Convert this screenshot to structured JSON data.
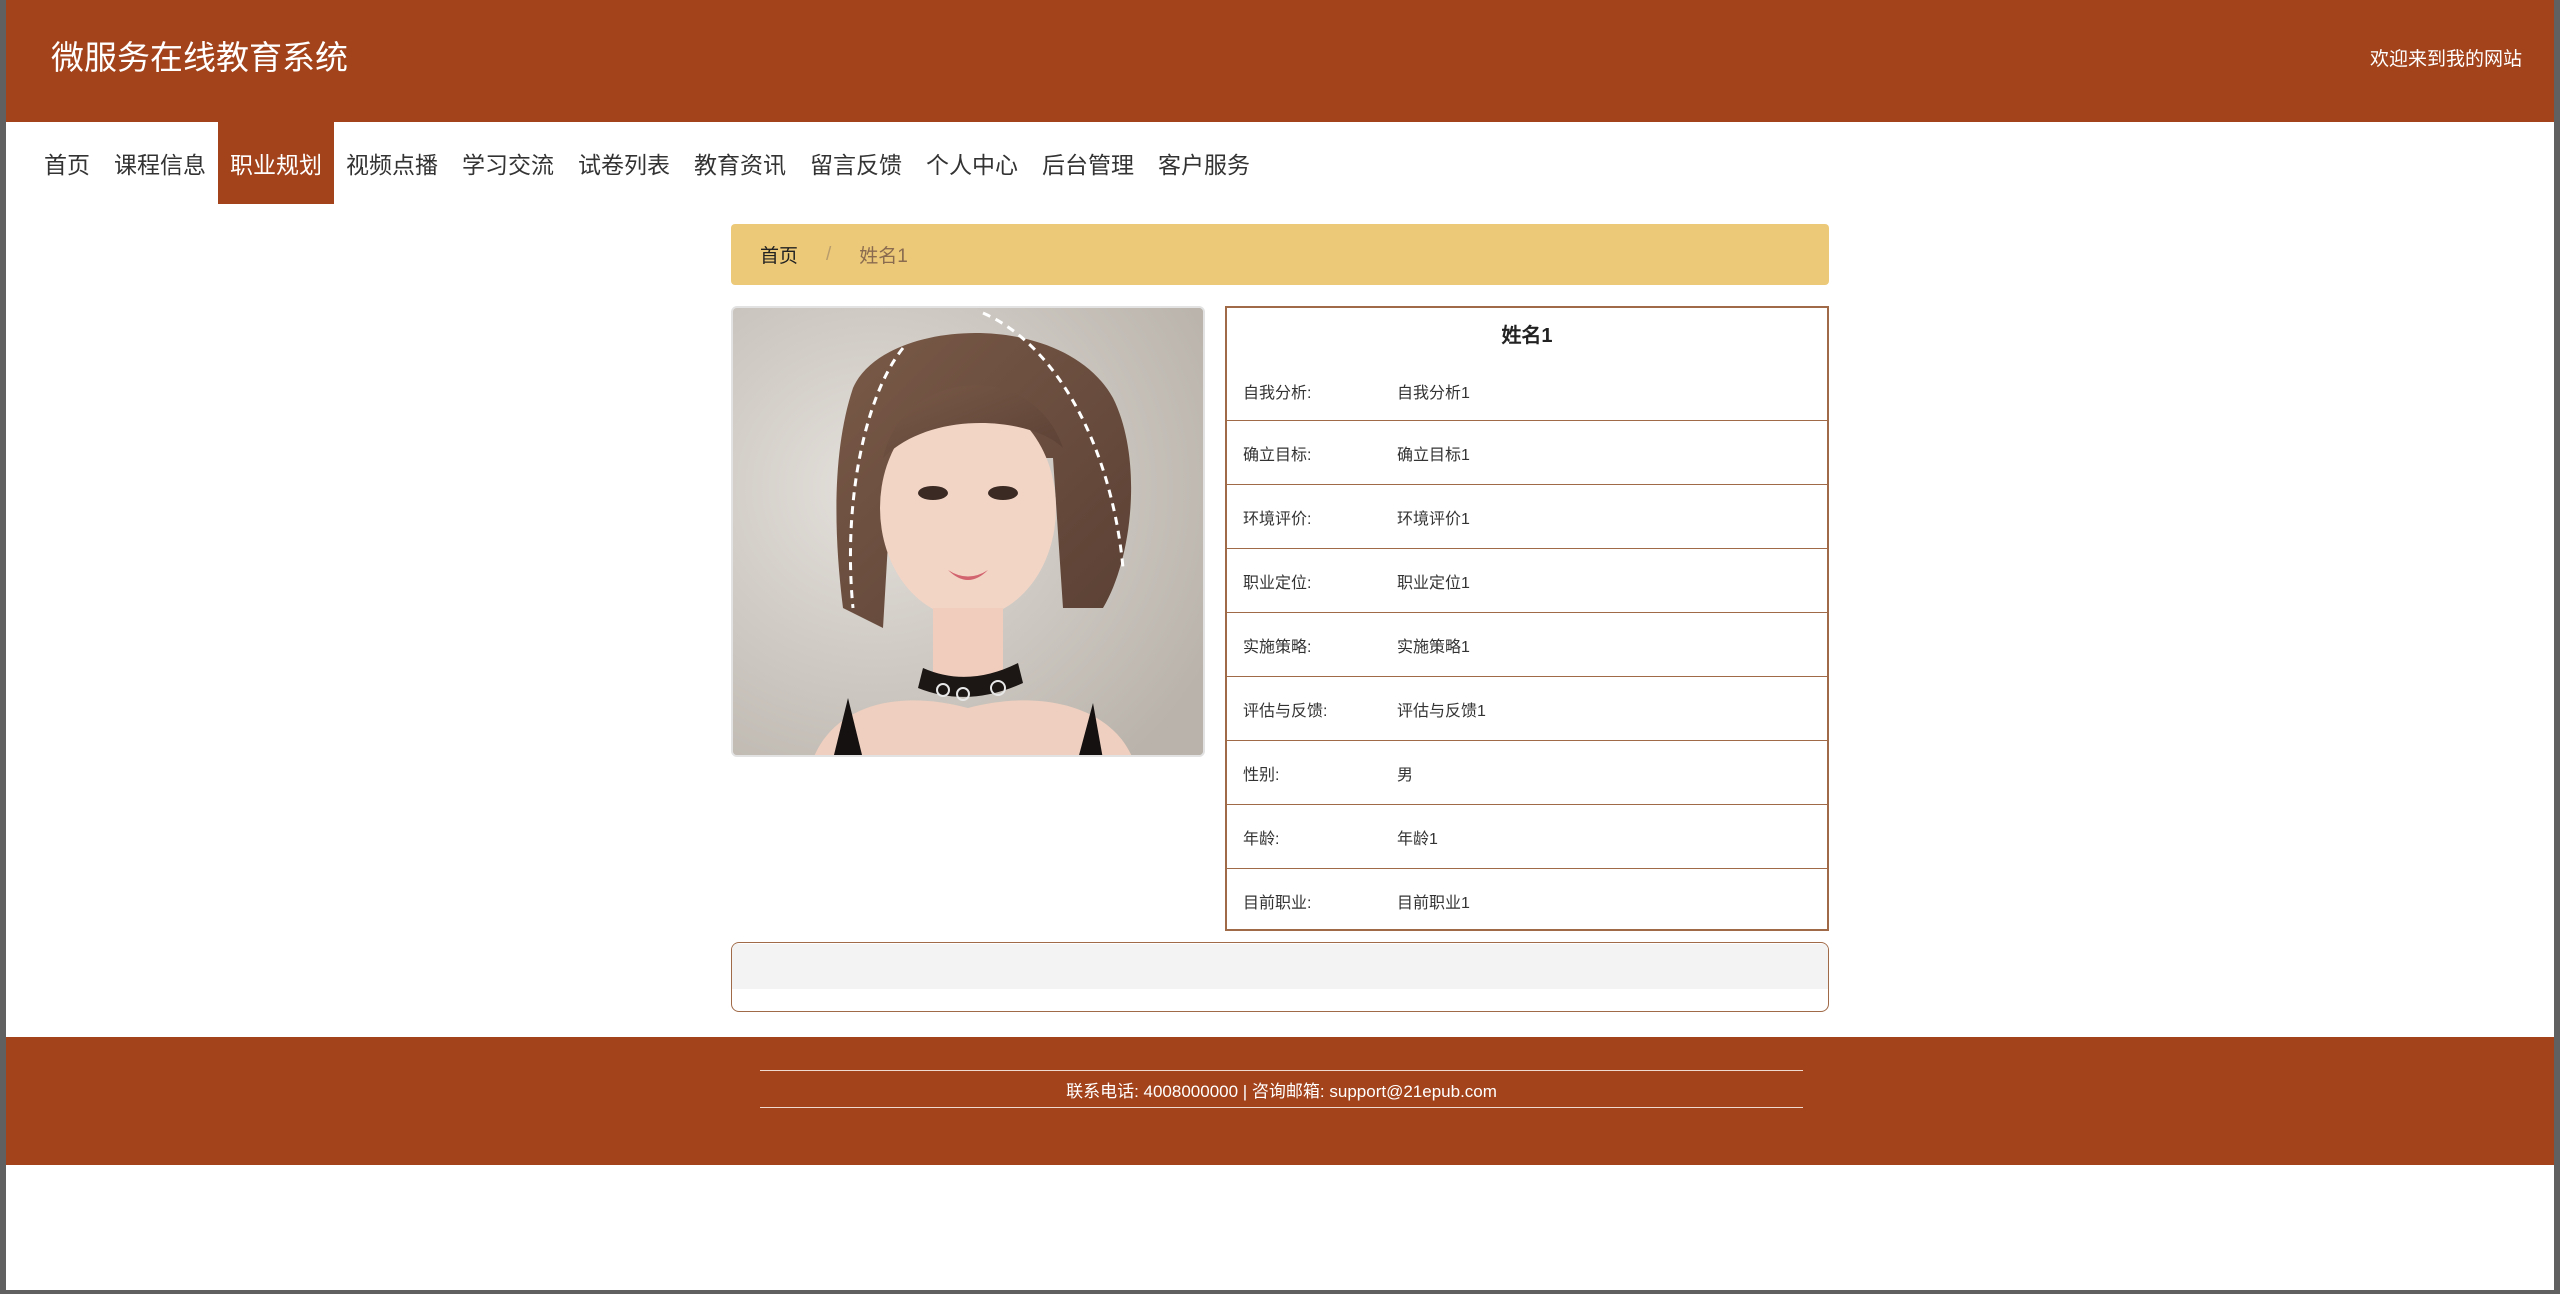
{
  "header": {
    "site_title": "微服务在线教育系统",
    "welcome": "欢迎来到我的网站"
  },
  "nav": {
    "items": [
      {
        "label": "首页",
        "active": false
      },
      {
        "label": "课程信息",
        "active": false
      },
      {
        "label": "职业规划",
        "active": true
      },
      {
        "label": "视频点播",
        "active": false
      },
      {
        "label": "学习交流",
        "active": false
      },
      {
        "label": "试卷列表",
        "active": false
      },
      {
        "label": "教育资讯",
        "active": false
      },
      {
        "label": "留言反馈",
        "active": false
      },
      {
        "label": "个人中心",
        "active": false
      },
      {
        "label": "后台管理",
        "active": false
      },
      {
        "label": "客户服务",
        "active": false
      }
    ]
  },
  "breadcrumb": {
    "home": "首页",
    "separator": "/",
    "current": "姓名1"
  },
  "detail": {
    "title": "姓名1",
    "rows": [
      {
        "label": "自我分析:",
        "value": "自我分析1"
      },
      {
        "label": "确立目标:",
        "value": "确立目标1"
      },
      {
        "label": "环境评价:",
        "value": "环境评价1"
      },
      {
        "label": "职业定位:",
        "value": "职业定位1"
      },
      {
        "label": "实施策略:",
        "value": "实施策略1"
      },
      {
        "label": "评估与反馈:",
        "value": "评估与反馈1"
      },
      {
        "label": "性别:",
        "value": "男"
      },
      {
        "label": "年龄:",
        "value": "年龄1"
      },
      {
        "label": "目前职业:",
        "value": "目前职业1"
      }
    ]
  },
  "footer": {
    "contact": "联系电话: 4008000000 | 咨询邮箱: support@21epub.com"
  },
  "colors": {
    "brand": "#a2431c",
    "breadcrumb_bg": "#ecc978",
    "border": "#a06a48"
  }
}
